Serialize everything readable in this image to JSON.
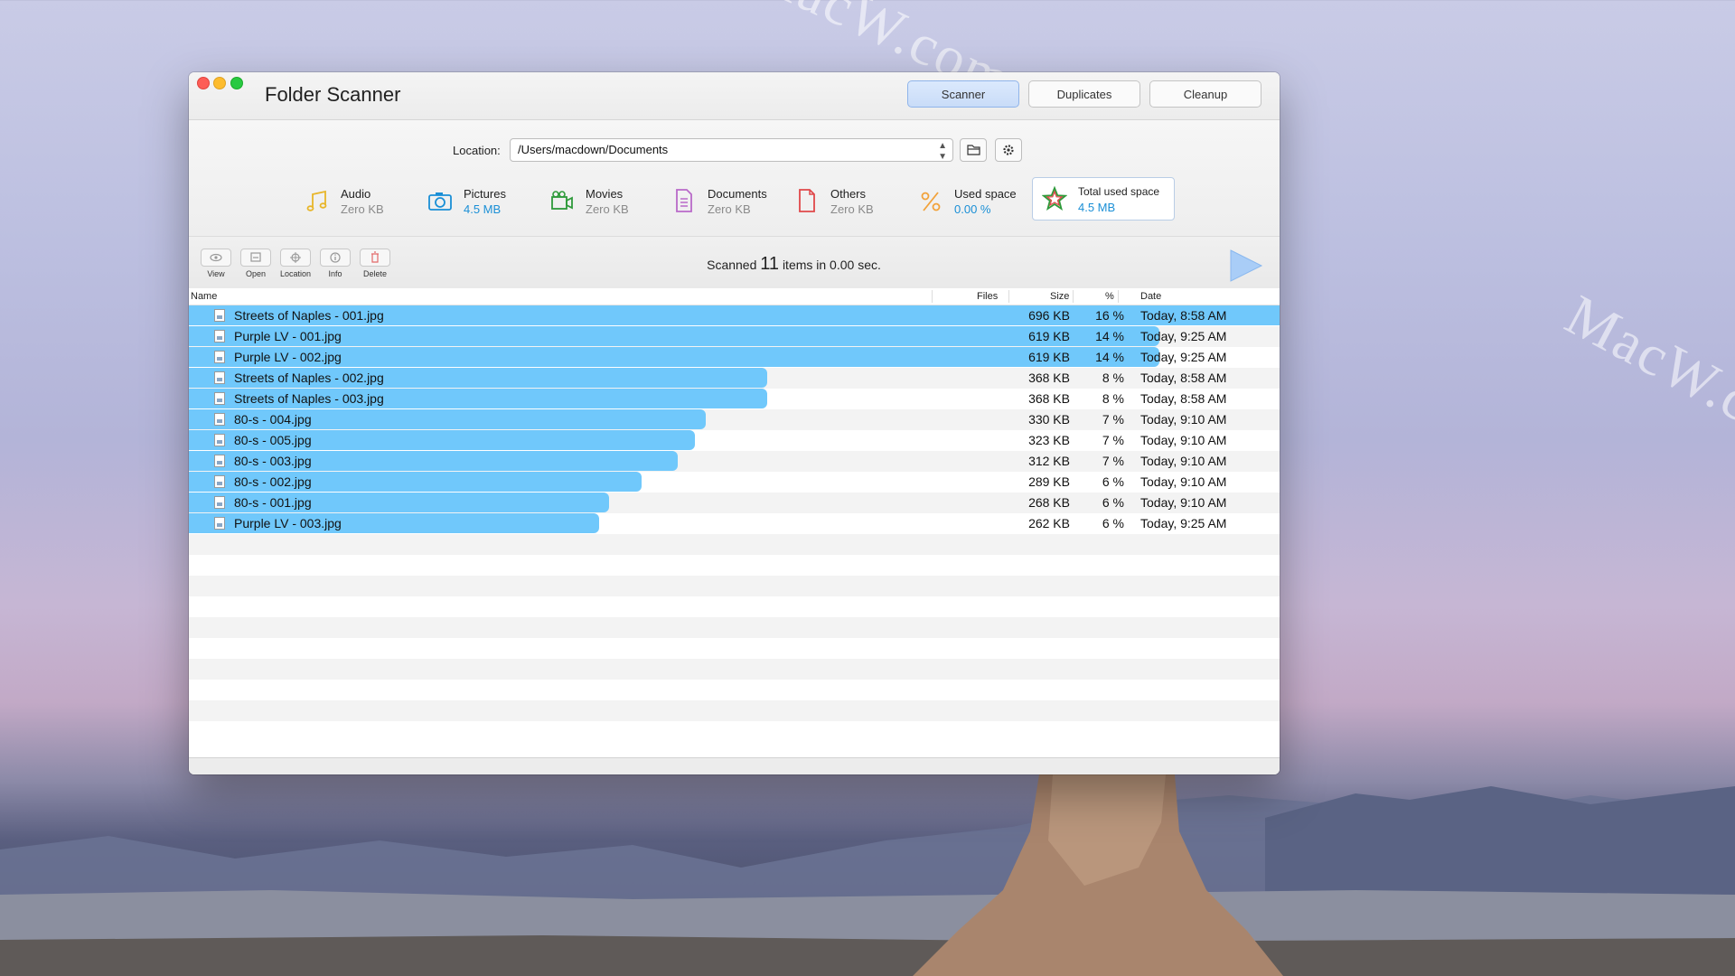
{
  "window": {
    "title": "Folder Scanner",
    "tabs": [
      {
        "label": "Scanner",
        "active": true
      },
      {
        "label": "Duplicates",
        "active": false
      },
      {
        "label": "Cleanup",
        "active": false
      }
    ]
  },
  "location": {
    "label": "Location:",
    "path": "/Users/macdown/Documents"
  },
  "categories": [
    {
      "name": "Audio",
      "value": "Zero KB",
      "icon": "music-note-icon",
      "color": "#e8b62a"
    },
    {
      "name": "Pictures",
      "value": "4.5 MB",
      "icon": "camera-icon",
      "color": "#1a8fd6"
    },
    {
      "name": "Movies",
      "value": "Zero KB",
      "icon": "video-camera-icon",
      "color": "#2e9a3a"
    },
    {
      "name": "Documents",
      "value": "Zero KB",
      "icon": "document-icon",
      "color": "#b96ac9"
    },
    {
      "name": "Others",
      "value": "Zero KB",
      "icon": "file-icon",
      "color": "#e0484a"
    },
    {
      "name": "Used space",
      "value": "0.00 %",
      "icon": "percent-icon",
      "color": "#f2a23a"
    },
    {
      "name": "Total used space",
      "value": "4.5 MB",
      "icon": "star-icon",
      "color": "#1a8fd6"
    }
  ],
  "toolbar": {
    "view": "View",
    "open": "Open",
    "location": "Location",
    "info": "Info",
    "delete": "Delete"
  },
  "scan": {
    "prefix": "Scanned",
    "count": "11",
    "suffix": "items in 0.00 sec."
  },
  "columns": {
    "name": "Name",
    "files": "Files",
    "size": "Size",
    "percent": "%",
    "date": "Date"
  },
  "files": [
    {
      "name": "Streets of Naples - 001.jpg",
      "size": "696 KB",
      "percent": "16 %",
      "date": "Today, 8:58 AM",
      "bar_fraction": 1.0
    },
    {
      "name": "Purple LV - 001.jpg",
      "size": "619 KB",
      "percent": "14 %",
      "date": "Today, 9:25 AM",
      "bar_fraction": 0.89
    },
    {
      "name": "Purple LV - 002.jpg",
      "size": "619 KB",
      "percent": "14 %",
      "date": "Today, 9:25 AM",
      "bar_fraction": 0.89
    },
    {
      "name": "Streets of Naples - 002.jpg",
      "size": "368 KB",
      "percent": "8 %",
      "date": "Today, 8:58 AM",
      "bar_fraction": 0.53
    },
    {
      "name": "Streets of Naples - 003.jpg",
      "size": "368 KB",
      "percent": "8 %",
      "date": "Today, 8:58 AM",
      "bar_fraction": 0.53
    },
    {
      "name": "80-s - 004.jpg",
      "size": "330 KB",
      "percent": "7 %",
      "date": "Today, 9:10 AM",
      "bar_fraction": 0.474
    },
    {
      "name": "80-s - 005.jpg",
      "size": "323 KB",
      "percent": "7 %",
      "date": "Today, 9:10 AM",
      "bar_fraction": 0.464
    },
    {
      "name": "80-s - 003.jpg",
      "size": "312 KB",
      "percent": "7 %",
      "date": "Today, 9:10 AM",
      "bar_fraction": 0.448
    },
    {
      "name": "80-s - 002.jpg",
      "size": "289 KB",
      "percent": "6 %",
      "date": "Today, 9:10 AM",
      "bar_fraction": 0.415
    },
    {
      "name": "80-s - 001.jpg",
      "size": "268 KB",
      "percent": "6 %",
      "date": "Today, 9:10 AM",
      "bar_fraction": 0.385
    },
    {
      "name": "Purple LV - 003.jpg",
      "size": "262 KB",
      "percent": "6 %",
      "date": "Today, 9:25 AM",
      "bar_fraction": 0.376
    }
  ],
  "watermark": "MacW.com"
}
